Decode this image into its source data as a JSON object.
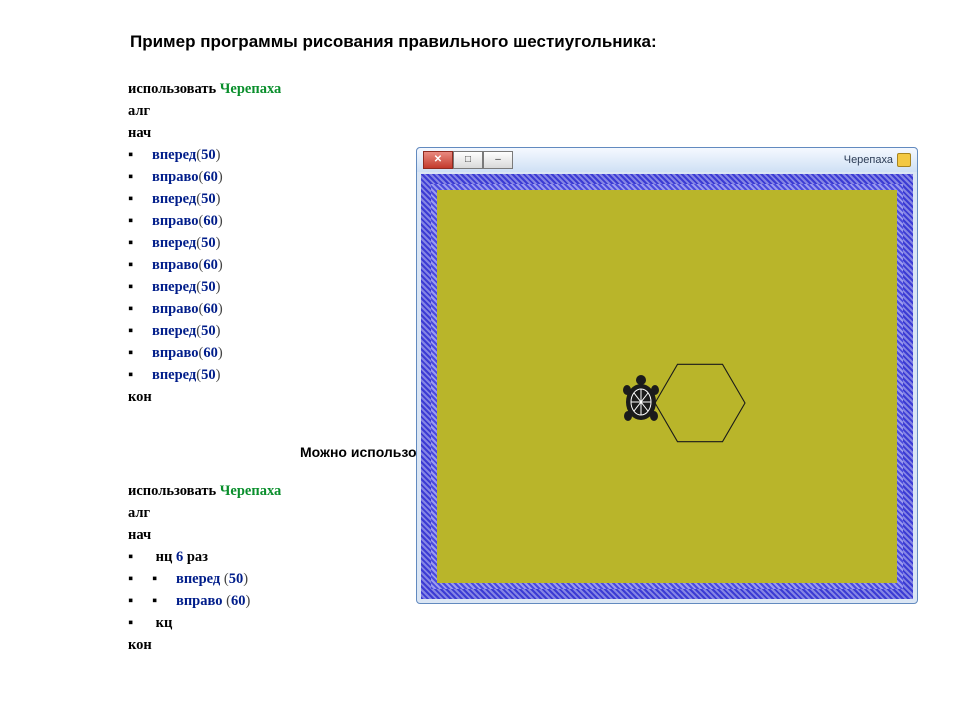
{
  "heading": "Пример программы рисования правильного шестиугольника:",
  "subheading": "Можно использовать к",
  "code1": {
    "l0_use": "использовать",
    "l0_mod": "Черепаха",
    "l1": "алг",
    "l2": "нач",
    "cmds": [
      {
        "name": "вперед",
        "arg": "50"
      },
      {
        "name": "вправо",
        "arg": "60"
      },
      {
        "name": "вперед",
        "arg": "50"
      },
      {
        "name": "вправо",
        "arg": "60"
      },
      {
        "name": "вперед",
        "arg": "50"
      },
      {
        "name": "вправо",
        "arg": "60"
      },
      {
        "name": "вперед",
        "arg": "50"
      },
      {
        "name": "вправо",
        "arg": "60"
      },
      {
        "name": "вперед",
        "arg": "50"
      },
      {
        "name": "вправо",
        "arg": "60"
      },
      {
        "name": "вперед",
        "arg": "50"
      }
    ],
    "end": "кон"
  },
  "code2": {
    "l0_use": "использовать",
    "l0_mod": "Черепаха",
    "l1": "алг",
    "l2": "нач",
    "loop_kw_start": "нц",
    "loop_count": "6",
    "loop_kw_times": "раз",
    "body": [
      {
        "name": "вперед",
        "arg": "50"
      },
      {
        "name": "вправо",
        "arg": "60"
      }
    ],
    "loop_end": "кц",
    "end": "кон"
  },
  "window": {
    "title": "Черепаха",
    "close": "✕",
    "max": "□",
    "min": "–"
  }
}
